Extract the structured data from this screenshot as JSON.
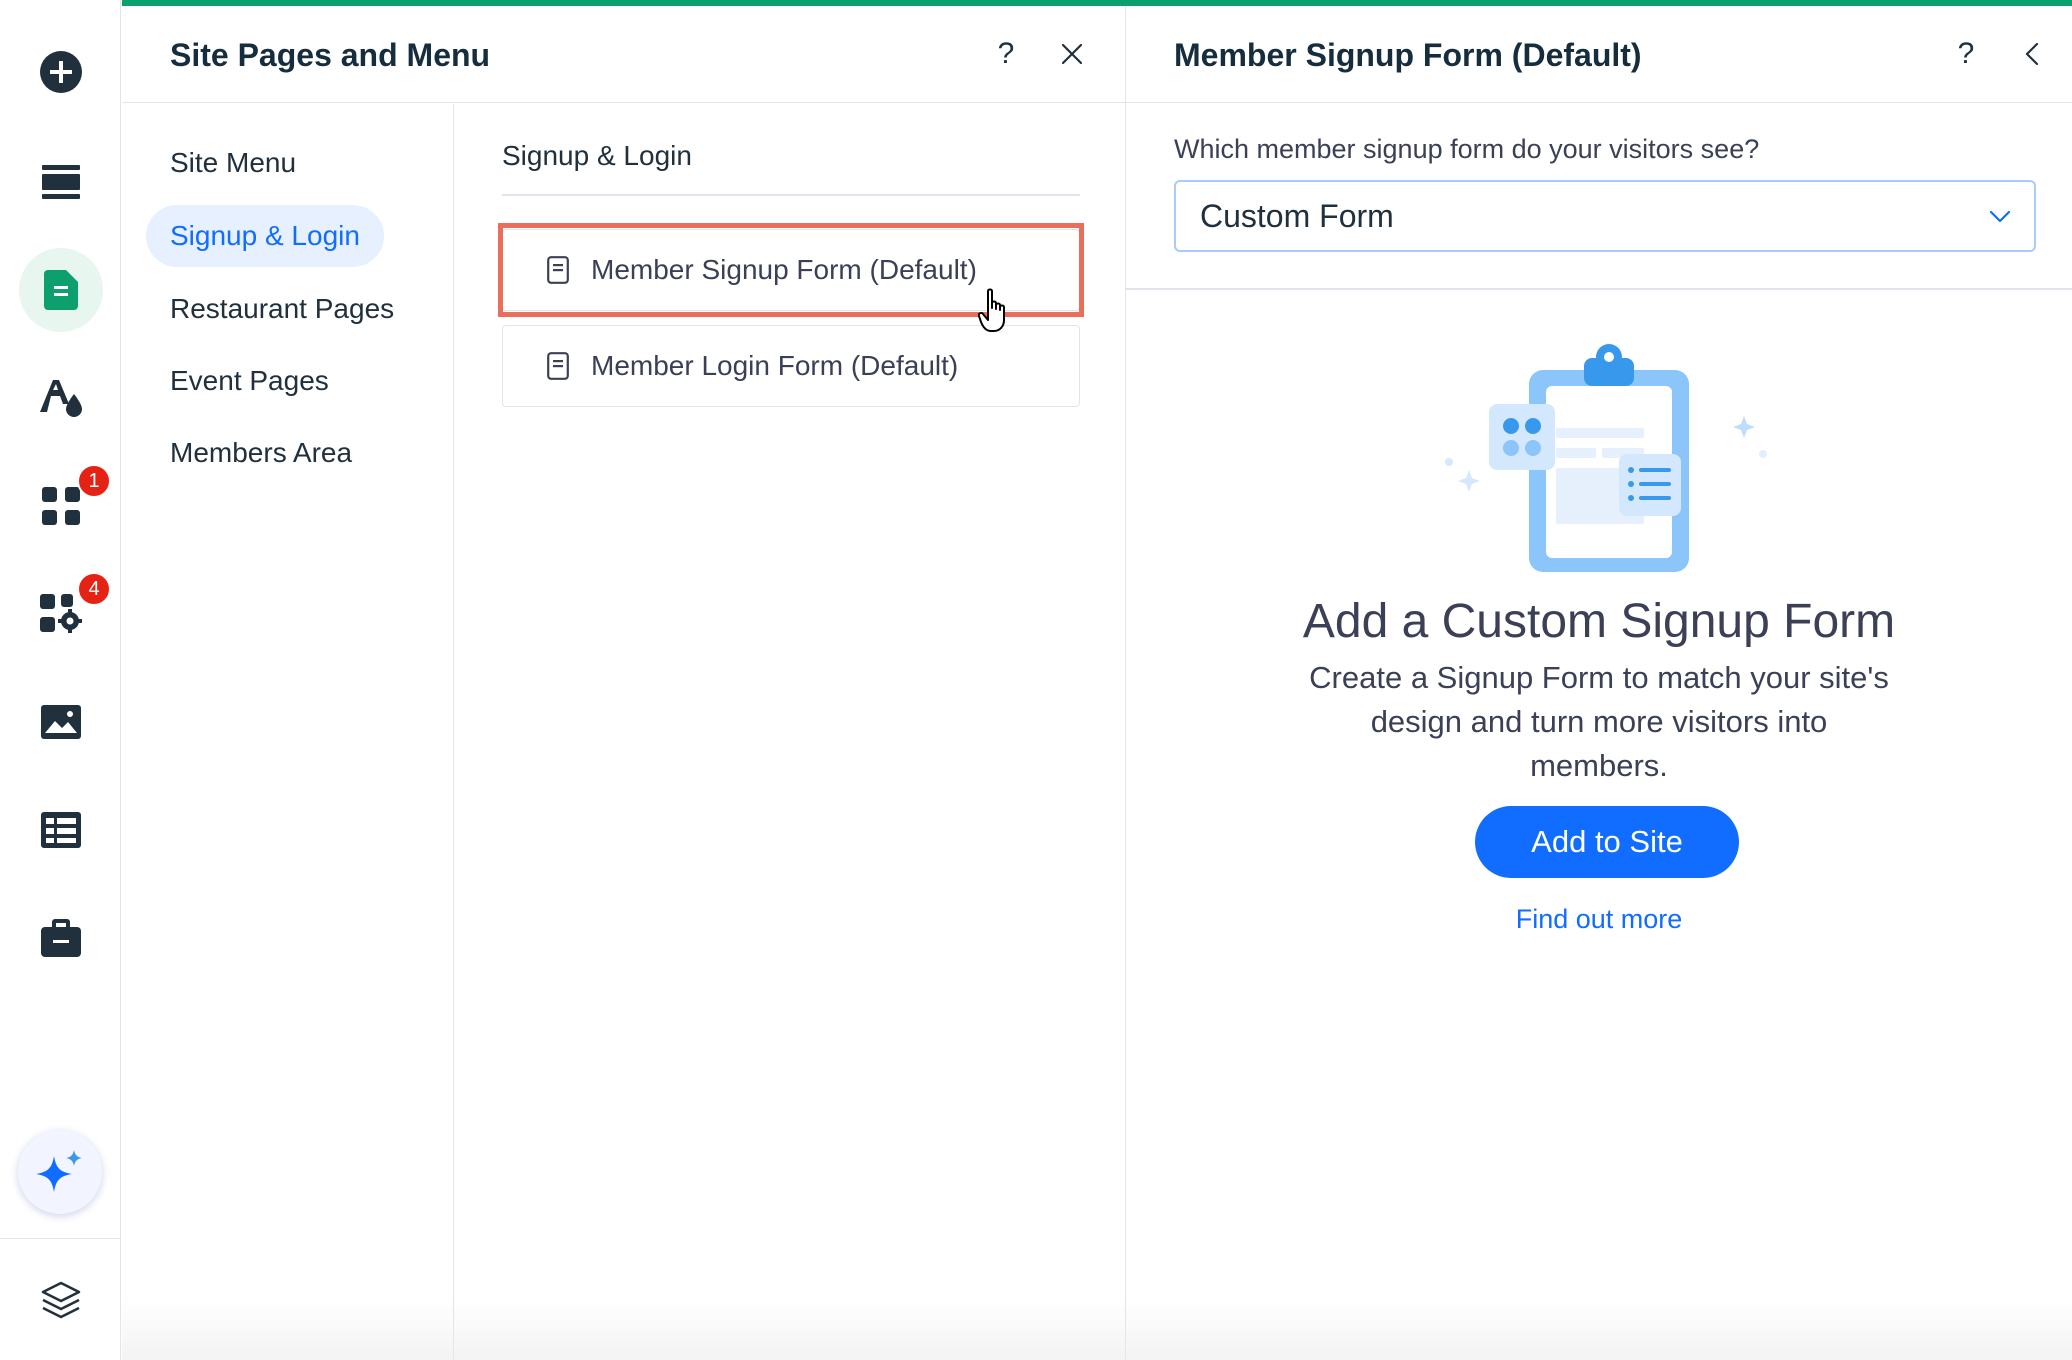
{
  "left_rail": {
    "items": [
      {
        "icon": "add-icon"
      },
      {
        "icon": "sections-icon"
      },
      {
        "icon": "pages-icon",
        "active": true
      },
      {
        "icon": "site-design-icon"
      },
      {
        "icon": "apps-icon",
        "badge": "1"
      },
      {
        "icon": "business-apps-icon",
        "badge": "4"
      },
      {
        "icon": "media-icon"
      },
      {
        "icon": "cms-icon"
      },
      {
        "icon": "portfolio-icon"
      }
    ],
    "ai_icon": "ai-sparkle-icon",
    "layers_icon": "layers-icon"
  },
  "site_pages_panel": {
    "title": "Site Pages and Menu",
    "help_label": "?",
    "nav": [
      {
        "label": "Site Menu"
      },
      {
        "label": "Signup & Login",
        "active": true
      },
      {
        "label": "Restaurant Pages"
      },
      {
        "label": "Event Pages"
      },
      {
        "label": "Members Area"
      }
    ],
    "section_heading": "Signup & Login",
    "pages": [
      {
        "label": "Member Signup Form (Default)",
        "highlighted": true
      },
      {
        "label": "Member Login Form (Default)"
      }
    ]
  },
  "signup_form_panel": {
    "title": "Member Signup Form (Default)",
    "help_label": "?",
    "question": "Which member signup form do your visitors see?",
    "selected_option": "Custom Form",
    "empty_state": {
      "title": "Add a Custom Signup Form",
      "description": "Create a Signup Form to match your site's design and turn more visitors into members.",
      "button": "Add to Site",
      "link": "Find out more"
    }
  },
  "colors": {
    "accent": "#116dff",
    "highlight": "#ea6e5a",
    "top_line": "#0e9f6e",
    "badge": "#e62214"
  }
}
